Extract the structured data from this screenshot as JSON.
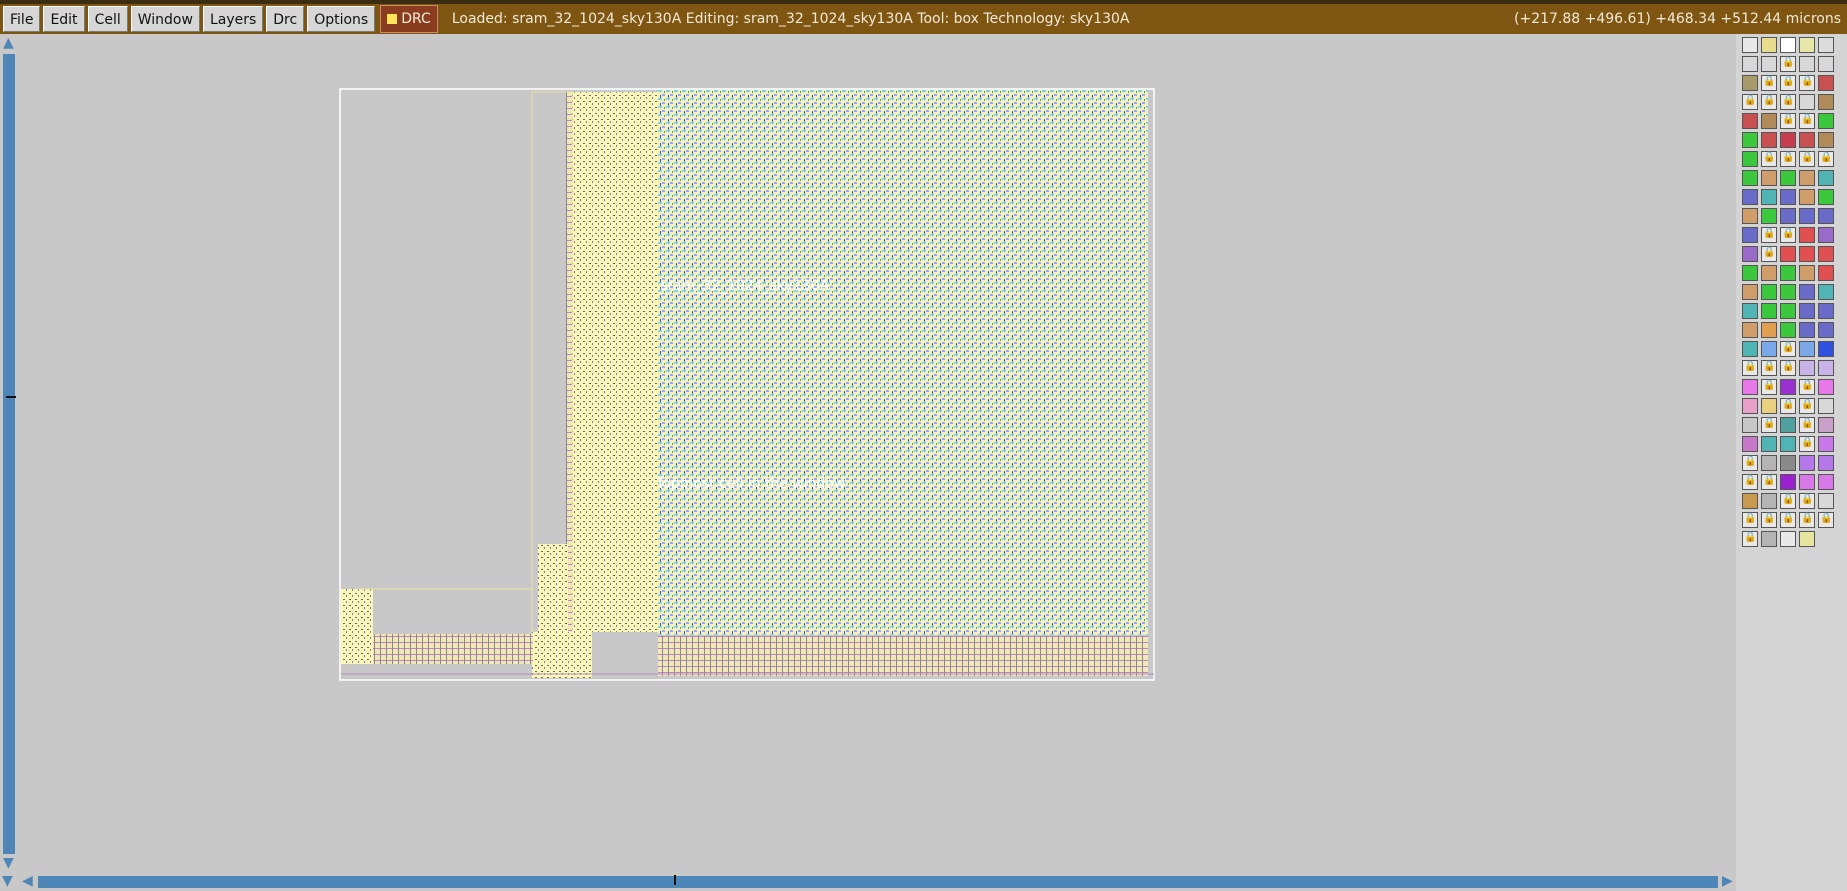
{
  "menu": {
    "file": "File",
    "edit": "Edit",
    "cell": "Cell",
    "window": "Window",
    "layers": "Layers",
    "drc": "Drc",
    "options": "Options"
  },
  "drc_toggle": {
    "label": "DRC",
    "indicator_color": "#ffe45a"
  },
  "status": {
    "text": "Loaded: sram_32_1024_sky130A Editing: sram_32_1024_sky130A Tool: box  Technology: sky130A",
    "coords": "(+217.88 +496.61) +468.34 +512.44 microns"
  },
  "layout": {
    "cell_name_label": "sram_32_1024_sky130A",
    "topmost_label": "Topmost cell in the window"
  },
  "palette": {
    "rows": [
      [
        "#e8e8e8",
        "#eadc8f",
        "#ffffff",
        "#e6e6a8",
        "#dcdcdc"
      ],
      [
        "#d8d8d8",
        "#d8d8d8",
        "lock",
        "#d8d8d8",
        "#d8d8d8"
      ],
      [
        "#a89a6a",
        "lock",
        "lock",
        "lock",
        "#c85050"
      ],
      [
        "lock",
        "lock",
        "lock",
        "#d8d8d8",
        "#b08a58"
      ],
      [
        "#c85050",
        "#b08a58",
        "lock",
        "lock",
        "#3cc83c"
      ],
      [
        "#3cc83c",
        "#c85050",
        "#c83c50",
        "#c85050",
        "#b08a58"
      ],
      [
        "#3cc83c",
        "lock",
        "lock",
        "lock",
        "lock"
      ],
      [
        "#3cc83c",
        "#cf9e6a",
        "#3cc83c",
        "#cf9e6a",
        "#50b4b4"
      ],
      [
        "#6a6ac8",
        "#50b4b4",
        "#6a6ac8",
        "#cf9e6a",
        "#3cc83c"
      ],
      [
        "#cf9e6a",
        "#3cc83c",
        "#6a6ac8",
        "#6a6ac8",
        "#6a6ac8"
      ],
      [
        "#6a6ac8",
        "lock",
        "lock",
        "#e05050",
        "#9a6ac8"
      ],
      [
        "#9a6ac8",
        "lock",
        "#e05050",
        "#e05050",
        "#e05050"
      ],
      [
        "#3cc83c",
        "#cf9e6a",
        "#3cc83c",
        "#cf9e6a",
        "#e05050"
      ],
      [
        "#cf9e6a",
        "#3cc83c",
        "#3cc83c",
        "#6a6ac8",
        "#50b4b4"
      ],
      [
        "#50b4b4",
        "#3cc83c",
        "#3cc83c",
        "#6a6ac8",
        "#6a6ac8"
      ],
      [
        "#cf9e6a",
        "#e0a050",
        "#3cc83c",
        "#6a6ac8",
        "#6a6ac8"
      ],
      [
        "#50b4b4",
        "#7aa8e8",
        "lock",
        "#7aa8e8",
        "#3050e0"
      ],
      [
        "lock",
        "lock",
        "lock",
        "#c8b4e8",
        "#c8b4e8"
      ],
      [
        "#e878e8",
        "lock",
        "#9a30d0",
        "lock",
        "#e878e8"
      ],
      [
        "#e8a0c8",
        "#e8d080",
        "lock",
        "lock",
        "#d8d8d8"
      ],
      [
        "#c8c8c8",
        "lock",
        "#50a0a0",
        "lock",
        "#c8a0c8"
      ],
      [
        "#c878c8",
        "#50b4b4",
        "#50b4b4",
        "lock",
        "#c878e8"
      ],
      [
        "lock",
        "#b4b4b4",
        "#8a8a8a",
        "#b478e8",
        "#b478e8"
      ],
      [
        "lock",
        "lock",
        "#9a20d0",
        "#d878e8",
        "#d878e8"
      ],
      [
        "#c89a50",
        "#b4b4b4",
        "lock",
        "lock",
        "#d8d8d8"
      ],
      [
        "lock",
        "lock",
        "lock",
        "lock",
        "lock"
      ],
      [
        "lock",
        "#b4b4b4",
        "#e8e8e8",
        "#e6e6a0",
        ""
      ]
    ]
  }
}
